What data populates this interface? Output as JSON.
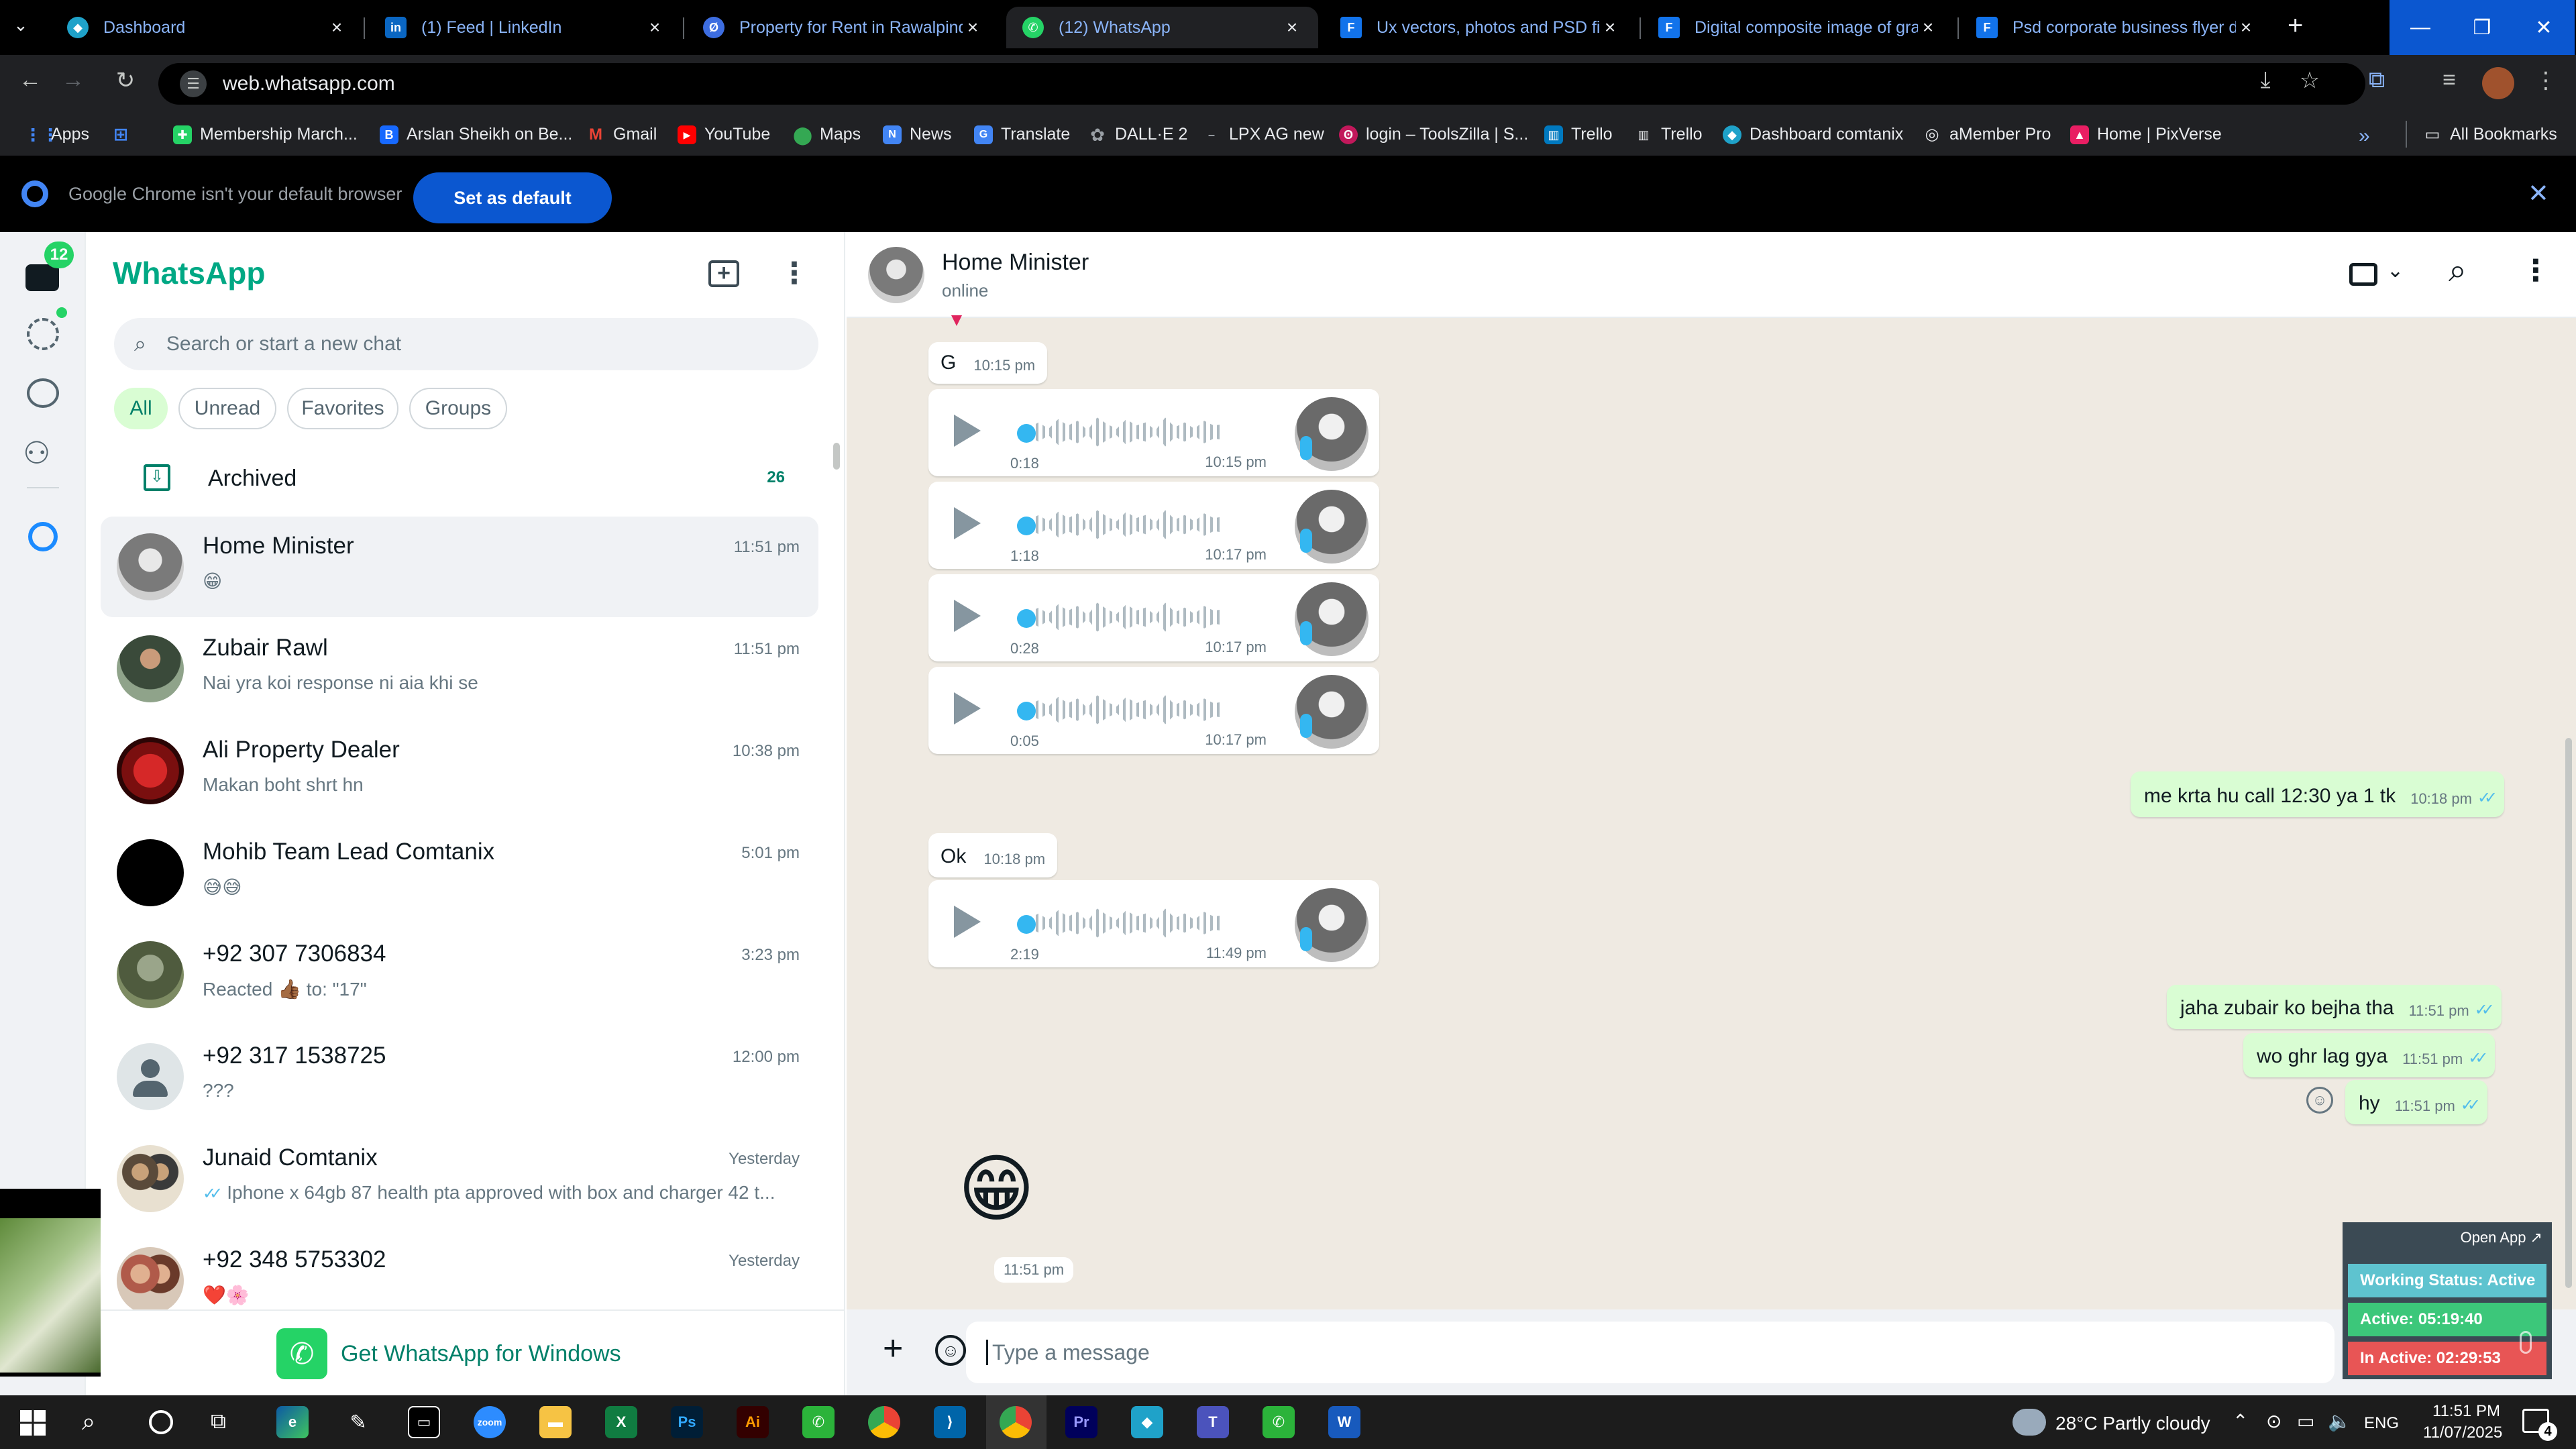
{
  "browser": {
    "tabs": [
      {
        "title": "Dashboard",
        "favicon_color": "#1fa2c9",
        "glyph": "◆"
      },
      {
        "title": "(1) Feed | LinkedIn",
        "favicon_color": "#0a66c2",
        "glyph": "in"
      },
      {
        "title": "Property for Rent in Rawalpindi",
        "favicon_color": "#3d6de0",
        "glyph": "Ø"
      },
      {
        "title": "(12) WhatsApp",
        "favicon_color": "#25d366",
        "glyph": "✆"
      },
      {
        "title": "Ux vectors, photos and PSD files",
        "favicon_color": "#1273eb",
        "glyph": "F"
      },
      {
        "title": "Digital composite image of gra",
        "favicon_color": "#1273eb",
        "glyph": "F"
      },
      {
        "title": "Psd corporate business flyer de",
        "favicon_color": "#1273eb",
        "glyph": "F"
      }
    ],
    "url": "web.whatsapp.com",
    "bookmarks": [
      {
        "label": "Apps",
        "color": "#4285f4"
      },
      {
        "label": "",
        "color": "#4285f4"
      },
      {
        "label": "Membership March...",
        "color": "#25d366"
      },
      {
        "label": "Arslan Sheikh on Be...",
        "color": "#1769ff"
      },
      {
        "label": "Gmail",
        "color": "#ea4335"
      },
      {
        "label": "YouTube",
        "color": "#ff0000"
      },
      {
        "label": "Maps",
        "color": "#34a853"
      },
      {
        "label": "News",
        "color": "#4285f4"
      },
      {
        "label": "Translate",
        "color": "#4285f4"
      },
      {
        "label": "DALL·E 2",
        "color": "#5f6368"
      },
      {
        "label": "LPX AG new",
        "color": "#202124"
      },
      {
        "label": "login – ToolsZilla | S...",
        "color": "#c2185b"
      },
      {
        "label": "Trello",
        "color": "#0079bf"
      },
      {
        "label": "Trello",
        "color": "#0079bf"
      },
      {
        "label": "Dashboard comtanix",
        "color": "#1fa2c9"
      },
      {
        "label": "aMember Pro",
        "color": "#5f6368"
      },
      {
        "label": "Home | PixVerse",
        "color": "#e91e63"
      }
    ],
    "all_bookmarks": "All Bookmarks",
    "infobar_text": "Google Chrome isn't your default browser",
    "set_default": "Set as default"
  },
  "whatsapp": {
    "unread_badge": "12",
    "title": "WhatsApp",
    "search_placeholder": "Search or start a new chat",
    "filters": [
      "All",
      "Unread",
      "Favorites",
      "Groups"
    ],
    "archived_label": "Archived",
    "archived_count": "26",
    "chats": [
      {
        "name": "Home Minister",
        "preview": "😁",
        "time": "11:51 pm",
        "avatar_color": "#9a9a9a"
      },
      {
        "name": "Zubair Rawl",
        "preview": "Nai yra koi response ni aia khi se",
        "time": "11:51 pm",
        "avatar_color": "#6b7a6a"
      },
      {
        "name": "Ali Property Dealer",
        "preview": "Makan boht shrt hn",
        "time": "10:38 pm",
        "avatar_color": "#a11b1b"
      },
      {
        "name": "Mohib Team Lead Comtanix",
        "preview": "😅😅",
        "time": "5:01 pm",
        "avatar_color": "#000000"
      },
      {
        "name": "+92 307 7306834",
        "preview": "Reacted 👍🏾 to: \"17\"",
        "time": "3:23 pm",
        "avatar_color": "#6a7a4e"
      },
      {
        "name": "+92 317 1538725",
        "preview": "???",
        "time": "12:00 pm",
        "avatar_color": "#dfe5e7"
      },
      {
        "name": "Junaid Comtanix",
        "preview": "Iphone x 64gb 87 health pta approved with box and charger   42 t...",
        "time": "Yesterday",
        "avatar_color": "#8a7a5a"
      },
      {
        "name": "+92 348 5753302",
        "preview": "❤️🌸",
        "time": "Yesterday",
        "avatar_color": "#c48a6a"
      }
    ],
    "get_windows": "Get WhatsApp for Windows",
    "contact": {
      "name": "Home Minister",
      "status": "online"
    },
    "messages": {
      "g_text": "G",
      "g_time": "10:15 pm",
      "voice": [
        {
          "duration": "0:18",
          "time": "10:15 pm"
        },
        {
          "duration": "1:18",
          "time": "10:17 pm"
        },
        {
          "duration": "0:28",
          "time": "10:17 pm"
        },
        {
          "duration": "0:05",
          "time": "10:17 pm"
        }
      ],
      "out1_text": "me krta hu call 12:30 ya 1 tk",
      "out1_time": "10:18 pm",
      "ok_text": "Ok",
      "ok_time": "10:18 pm",
      "voice5": {
        "duration": "2:19",
        "time": "11:49 pm"
      },
      "out2_text": "jaha zubair ko bejha tha",
      "out2_time": "11:51 pm",
      "out3_text": "wo ghr lag gya",
      "out3_time": "11:51 pm",
      "out4_text": "hy",
      "out4_time": "11:51 pm",
      "emoji": "😁",
      "emoji_time": "11:51 pm"
    },
    "composer_placeholder": "Type a message"
  },
  "widget": {
    "open_app": "Open App ↗",
    "working": "Working Status: Active",
    "active": "Active: 05:19:40",
    "inactive": "In Active: 02:29:53"
  },
  "taskbar": {
    "weather": "28°C  Partly cloudy",
    "lang": "ENG",
    "time": "11:51 PM",
    "date": "11/07/2025",
    "notif_count": "4"
  }
}
